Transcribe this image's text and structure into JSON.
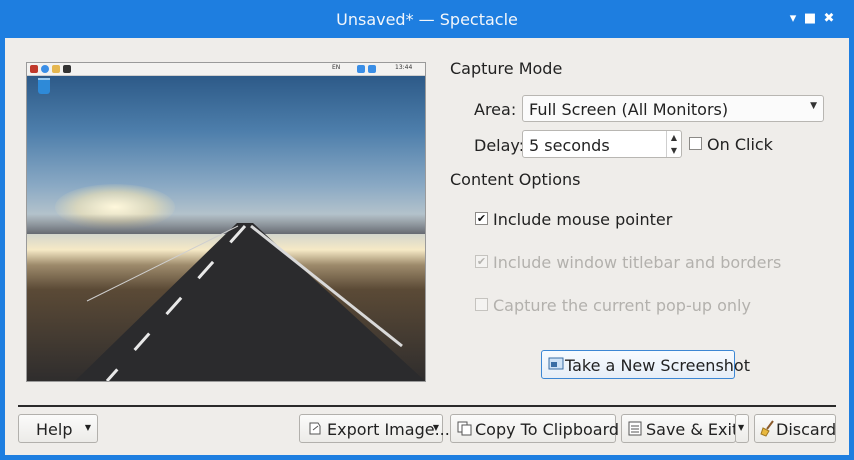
{
  "window": {
    "title": "Unsaved* — Spectacle"
  },
  "capture_mode": {
    "heading": "Capture Mode",
    "area_label": "Area:",
    "area_value": "Full Screen (All Monitors)",
    "delay_label": "Delay:",
    "delay_value": "5 seconds",
    "on_click_label": "On Click",
    "on_click_checked": false
  },
  "content_options": {
    "heading": "Content Options",
    "items": [
      {
        "label": "Include mouse pointer",
        "checked": true,
        "enabled": true
      },
      {
        "label": "Include window titlebar and borders",
        "checked": true,
        "enabled": false
      },
      {
        "label": "Capture the current pop-up only",
        "checked": false,
        "enabled": false
      }
    ]
  },
  "take_screenshot_label": "Take a New Screenshot",
  "preview_panel": {
    "clock": "13:44",
    "lang": "EN"
  },
  "buttons": {
    "help": "Help",
    "export": "Export Image...",
    "copy": "Copy To Clipboard",
    "save_exit": "Save & Exit",
    "discard": "Discard"
  },
  "colors": {
    "titlebar": "#1e7ee0",
    "background": "#efedea",
    "focus": "#3c87d4"
  },
  "icons": [
    "minimize-icon",
    "maximize-icon",
    "close-icon",
    "screenshot-icon",
    "export-icon",
    "clipboard-icon",
    "save-icon",
    "broom-icon"
  ]
}
